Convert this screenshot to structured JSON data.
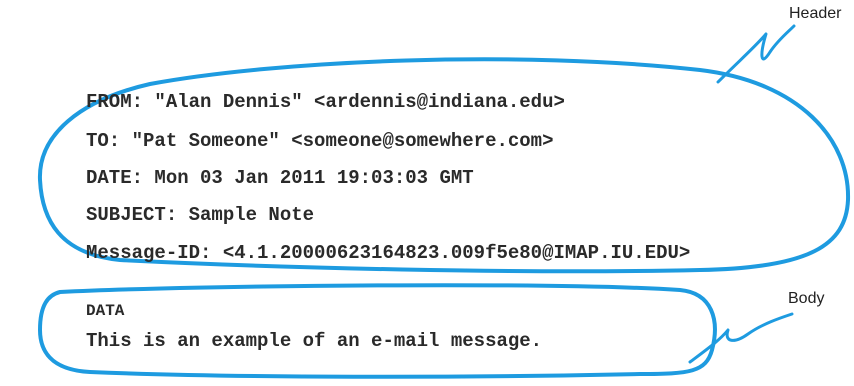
{
  "header_lines": [
    "FROM: \"Alan Dennis\" <ardennis@indiana.edu>",
    "TO: \"Pat Someone\" <someone@somewhere.com>",
    "DATE: Mon 03 Jan 2011 19:03:03 GMT",
    "SUBJECT: Sample Note",
    "Message-ID: <4.1.20000623164823.009f5e80@IMAP.IU.EDU>"
  ],
  "body": {
    "title": "DATA",
    "text": "This is an example of an e-mail message."
  },
  "callouts": {
    "header": "Header",
    "body": "Body"
  },
  "colors": {
    "outline": "#1e9be0",
    "text": "#2a2a2a"
  }
}
